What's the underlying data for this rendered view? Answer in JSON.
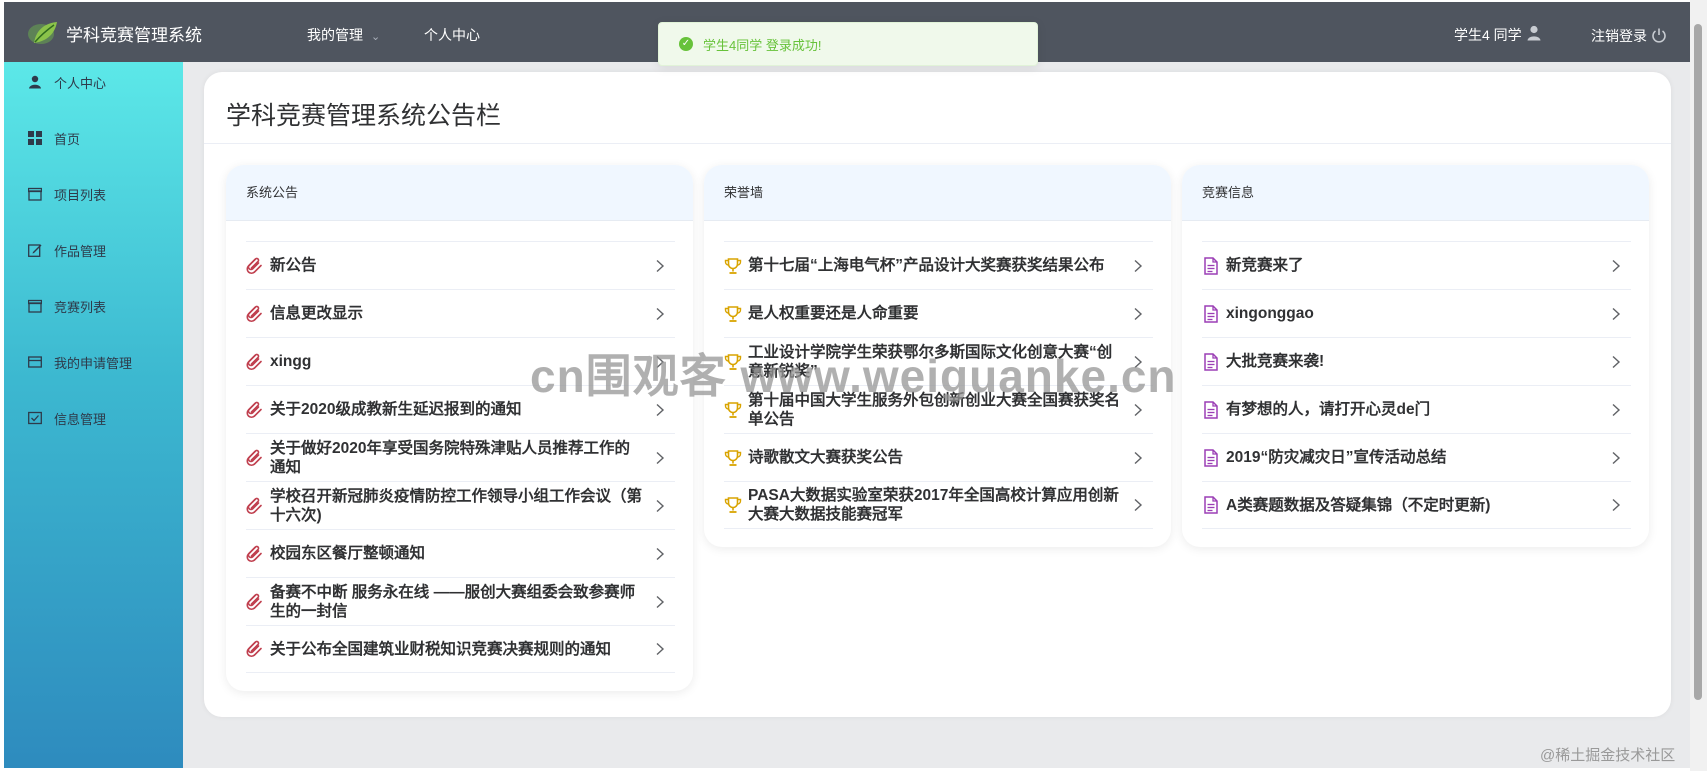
{
  "header": {
    "app_title": "学科竞赛管理系统",
    "nav": [
      {
        "label": "我的管理",
        "has_dropdown": true,
        "caret": "⌄"
      },
      {
        "label": "个人中心"
      }
    ],
    "user_label": "学生4 同学",
    "logout_label": "注销登录",
    "colors": {
      "bar": "#4f555f"
    }
  },
  "toast": {
    "message": "学生4同学 登录成功!",
    "icon": "check-circle-icon",
    "check": "✓",
    "color": "#67c23a"
  },
  "sidebar": {
    "items": [
      {
        "label": "个人中心",
        "icon": "user-icon"
      },
      {
        "label": "首页",
        "icon": "grid-icon"
      },
      {
        "label": "项目列表",
        "icon": "box-icon"
      },
      {
        "label": "作品管理",
        "icon": "edit-icon"
      },
      {
        "label": "竞赛列表",
        "icon": "box-icon"
      },
      {
        "label": "我的申请管理",
        "icon": "card-icon"
      },
      {
        "label": "信息管理",
        "icon": "check-square-icon"
      }
    ]
  },
  "board": {
    "title": "学科竞赛管理系统公告栏",
    "cards": [
      {
        "title": "系统公告",
        "icon": "paperclip-icon",
        "icon_color": "#c0404f",
        "items": [
          "新公告",
          "信息更改显示",
          "xingg",
          "关于2020级成教新生延迟报到的通知",
          "关于做好2020年享受国务院特殊津贴人员推荐工作的通知",
          "学校召开新冠肺炎疫情防控工作领导小组工作会议（第十六次)",
          "校园东区餐厅整顿通知",
          "备赛不中断 服务永在线 ——服创大赛组委会致参赛师生的一封信",
          "关于公布全国建筑业财税知识竞赛决赛规则的通知"
        ]
      },
      {
        "title": "荣誉墙",
        "icon": "trophy-icon",
        "icon_color": "#d9a400",
        "items": [
          "第十七届“上海电气杯”产品设计大奖赛获奖结果公布",
          "是人权重要还是人命重要",
          "工业设计学院学生荣获鄂尔多斯国际文化创意大赛“创意新锐奖”",
          "第十届中国大学生服务外包创新创业大赛全国赛获奖名单公告",
          "诗歌散文大赛获奖公告",
          "PASA大数据实验室荣获2017年全国高校计算应用创新大赛大数据技能赛冠军"
        ]
      },
      {
        "title": "竞赛信息",
        "icon": "document-icon",
        "icon_color": "#9b3fb5",
        "items": [
          "新竞赛来了",
          "xingonggao",
          "大批竞赛来袭!",
          "有梦想的人，请打开心灵de门",
          "2019“防灾减灾日”宣传活动总结",
          "A类赛题数据及答疑集锦（不定时更新)"
        ]
      }
    ]
  },
  "watermark": "cn围观客 www.weiguanke.cn",
  "credit": "@稀土掘金技术社区"
}
